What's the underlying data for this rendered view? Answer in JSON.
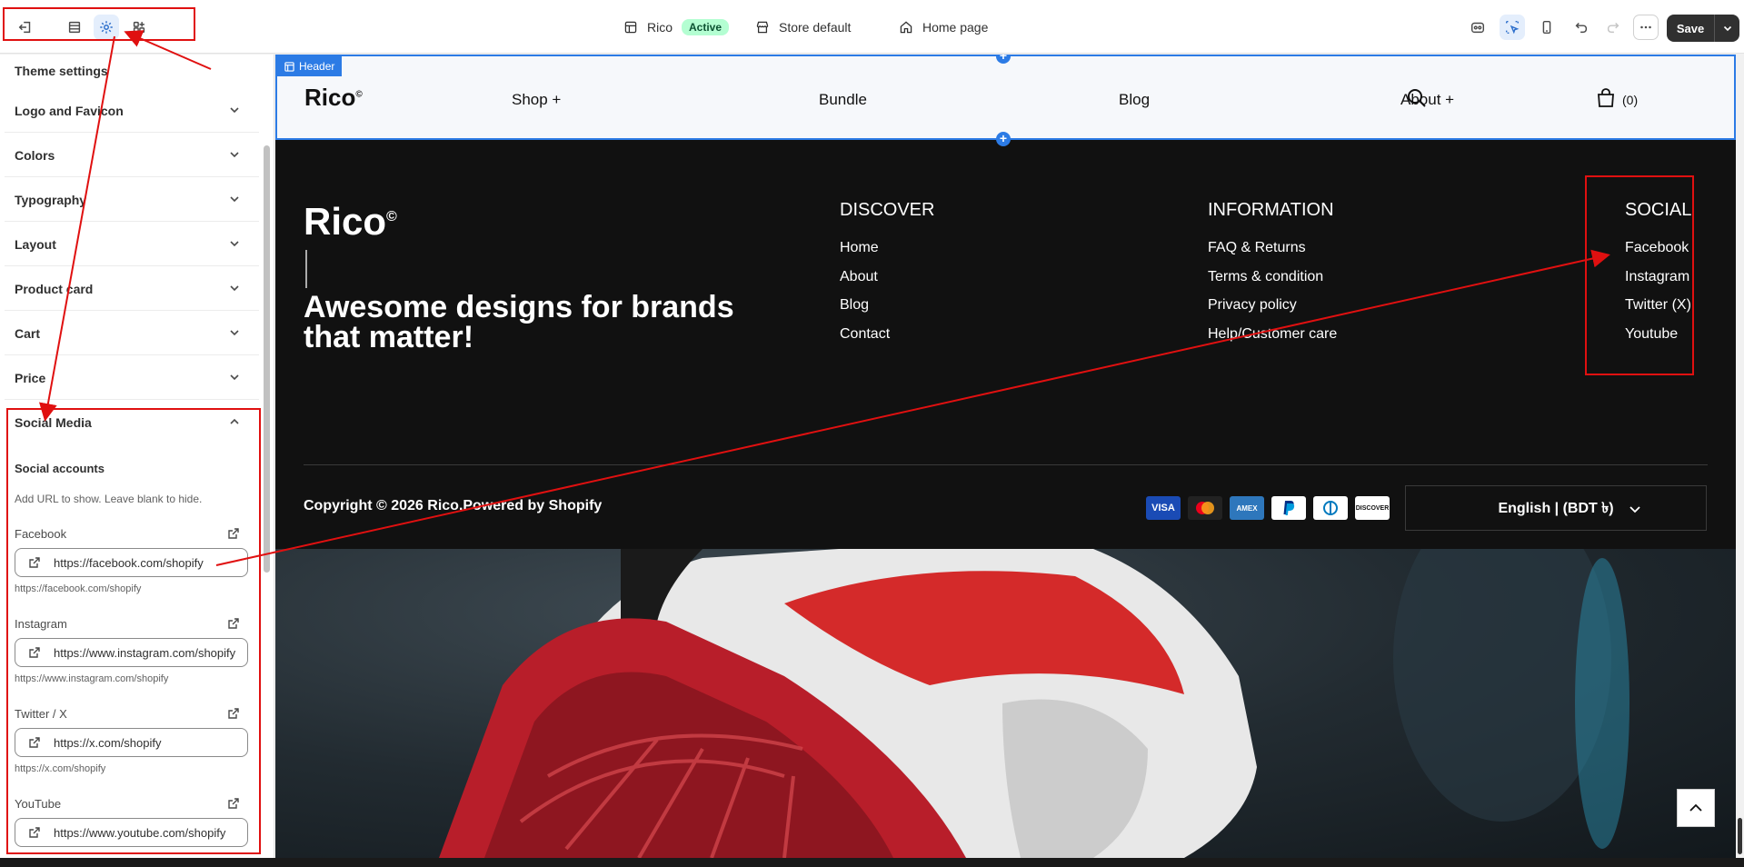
{
  "topbar": {
    "store_name": "Rico",
    "status": "Active",
    "store_context": "Store default",
    "page_label": "Home page",
    "save_label": "Save"
  },
  "sidebar": {
    "title": "Theme settings",
    "sections": [
      "Logo and Favicon",
      "Colors",
      "Typography",
      "Layout",
      "Product card",
      "Cart",
      "Price"
    ],
    "social_section": "Social Media",
    "social_heading": "Social accounts",
    "social_help": "Add URL to show. Leave blank to hide.",
    "fields": [
      {
        "label": "Facebook",
        "value": "https://facebook.com/shopify",
        "hint": "https://facebook.com/shopify"
      },
      {
        "label": "Instagram",
        "value": "https://www.instagram.com/shopify",
        "hint": "https://www.instagram.com/shopify"
      },
      {
        "label": "Twitter / X",
        "value": "https://x.com/shopify",
        "hint": "https://x.com/shopify"
      },
      {
        "label": "YouTube",
        "value": "https://www.youtube.com/shopify",
        "hint": ""
      }
    ]
  },
  "preview": {
    "header_tag": "Header",
    "logo": "Rico",
    "logo_mark": "©",
    "nav": [
      "Shop +",
      "Bundle",
      "Blog",
      "About +"
    ],
    "cart_count": "(0)",
    "footer": {
      "tagline": "Awesome designs for brands that matter!",
      "columns": [
        {
          "heading": "DISCOVER",
          "links": [
            "Home",
            "About",
            "Blog",
            "Contact"
          ]
        },
        {
          "heading": "INFORMATION",
          "links": [
            "FAQ & Returns",
            "Terms & condition",
            "Privacy policy",
            "Help/Customer care"
          ]
        },
        {
          "heading": "SOCIAL",
          "links": [
            "Facebook",
            "Instagram",
            "Twitter (X)",
            "Youtube"
          ]
        }
      ],
      "copyright": "Copyright © 2026 Rico.Powered by Shopify",
      "payments": [
        "VISA",
        "mastercard",
        "AMEX",
        "PayPal",
        "Diners",
        "DISCOVER"
      ],
      "language": "English | (BDT ৳)"
    }
  },
  "colors": {
    "accent": "#2c7be5",
    "annotation": "#e01010",
    "footer_bg": "#111111"
  }
}
